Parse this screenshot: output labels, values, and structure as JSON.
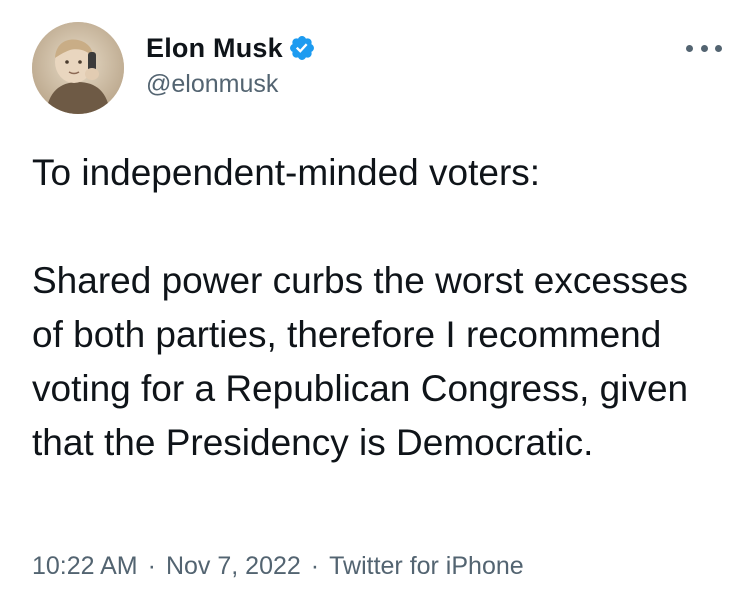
{
  "author": {
    "display_name": "Elon Musk",
    "handle": "@elonmusk",
    "verified": true,
    "avatar_icon": "child-photo-avatar"
  },
  "actions": {
    "more_icon": "ellipsis-icon"
  },
  "tweet": {
    "paragraphs": [
      "To independent-minded voters:",
      "Shared power curbs the worst excesses of both parties, therefore I recommend voting for a Republican Congress, given that the Presidency is Democratic."
    ]
  },
  "meta": {
    "time": "10:22 AM",
    "date": "Nov 7, 2022",
    "source": "Twitter for iPhone",
    "separator": "·"
  },
  "colors": {
    "text_primary": "#0f1419",
    "text_secondary": "#536471",
    "verified_blue": "#1d9bf0",
    "background": "#ffffff"
  }
}
